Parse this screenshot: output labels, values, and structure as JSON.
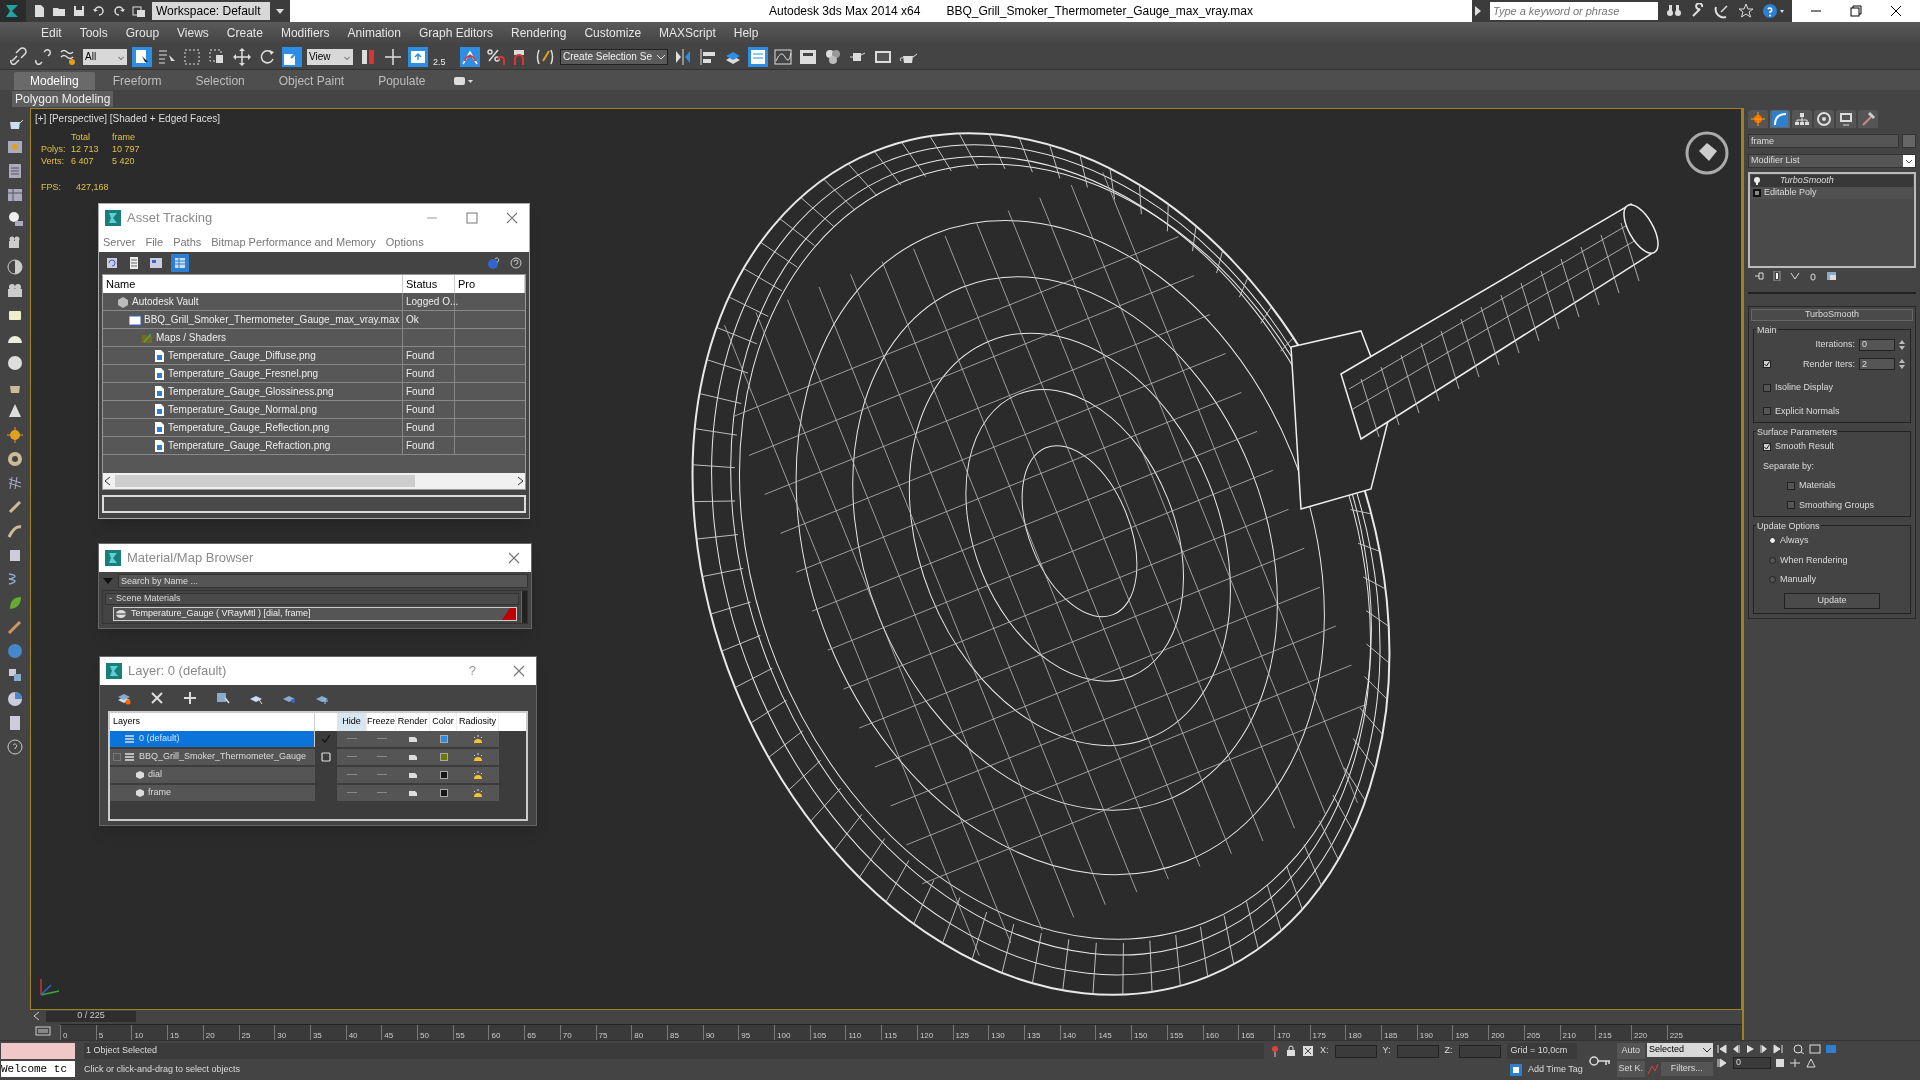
{
  "window": {
    "app_title": "Autodesk 3ds Max  2014 x64",
    "file_title": "BBQ_Grill_Smoker_Thermometer_Gauge_max_vray.max",
    "workspace": "Workspace: Default",
    "search_placeholder": "Type a keyword or phrase"
  },
  "menu": [
    "Edit",
    "Tools",
    "Group",
    "Views",
    "Create",
    "Modifiers",
    "Animation",
    "Graph Editors",
    "Rendering",
    "Customize",
    "MAXScript",
    "Help"
  ],
  "toolbar": {
    "selection_filter": "All",
    "reference_coord": "View",
    "snap_label": "2.5",
    "named_selection": "Create Selection Se"
  },
  "ribbon": {
    "tabs": [
      {
        "label": "Modeling",
        "selected": true
      },
      {
        "label": "Freeform",
        "selected": false
      },
      {
        "label": "Selection",
        "selected": false
      },
      {
        "label": "Object Paint",
        "selected": false
      },
      {
        "label": "Populate",
        "selected": false
      }
    ],
    "panel": "Polygon Modeling"
  },
  "viewport": {
    "label": "[+] [Perspective] [Shaded + Edged Faces]",
    "stats_header": [
      "Total",
      "frame"
    ],
    "stats": [
      {
        "label": "Polys:",
        "total": "12 713",
        "frame": "10 797"
      },
      {
        "label": "Verts:",
        "total": "6 407",
        "frame": "5 420"
      }
    ],
    "fps_label": "FPS:",
    "fps": "427,168"
  },
  "asset_tracking": {
    "title": "Asset Tracking",
    "menu": [
      "Server",
      "File",
      "Paths",
      "Bitmap Performance and Memory",
      "Options"
    ],
    "columns": [
      "Name",
      "Status",
      "Pro"
    ],
    "tree": [
      {
        "kind": "vault",
        "name": "Autodesk Vault",
        "status": "Logged O...",
        "children": [
          {
            "kind": "scene",
            "name": "BBQ_Grill_Smoker_Thermometer_Gauge_max_vray.max",
            "status": "Ok",
            "children": [
              {
                "kind": "folder",
                "name": "Maps / Shaders",
                "children": [
                  {
                    "kind": "bitmap",
                    "name": "Temperature_Gauge_Diffuse.png",
                    "status": "Found"
                  },
                  {
                    "kind": "bitmap",
                    "name": "Temperature_Gauge_Fresnel.png",
                    "status": "Found"
                  },
                  {
                    "kind": "bitmap",
                    "name": "Temperature_Gauge_Glossiness.png",
                    "status": "Found"
                  },
                  {
                    "kind": "bitmap",
                    "name": "Temperature_Gauge_Normal.png",
                    "status": "Found"
                  },
                  {
                    "kind": "bitmap",
                    "name": "Temperature_Gauge_Reflection.png",
                    "status": "Found"
                  },
                  {
                    "kind": "bitmap",
                    "name": "Temperature_Gauge_Refraction.png",
                    "status": "Found"
                  }
                ]
              }
            ]
          }
        ]
      }
    ]
  },
  "material_browser": {
    "title": "Material/Map Browser",
    "search_placeholder": "Search by Name ...",
    "group_toggle": "-",
    "group": "Scene Materials",
    "materials": [
      "Temperature_Gauge ( VRayMtl ) [dial, frame]"
    ]
  },
  "layer_dialog": {
    "title": "Layer: 0 (default)",
    "help": "?",
    "columns": [
      "Layers",
      "Hide",
      "Freeze",
      "Render",
      "Color",
      "Radiosity"
    ],
    "layers": [
      {
        "name": "0 (default)",
        "selected": true,
        "current": true,
        "color": "#2f8ae0"
      },
      {
        "name": "BBQ_Grill_Smoker_Thermometer_Gauge",
        "selected": false,
        "current": false,
        "expanded": true,
        "color": "#6b7a00",
        "children": [
          {
            "name": "dial",
            "color": "#151515"
          },
          {
            "name": "frame",
            "color": "#151515"
          }
        ]
      }
    ]
  },
  "command_panel": {
    "panel_tabs": [
      {
        "selected": false
      },
      {
        "selected": true
      },
      {
        "selected": false
      },
      {
        "selected": false
      },
      {
        "selected": false
      },
      {
        "selected": false
      }
    ],
    "object_name": "frame",
    "modifier_list": "Modifier List",
    "stack": [
      {
        "label": "TurboSmooth",
        "selected": true
      },
      {
        "label": "Editable Poly",
        "selected": false
      }
    ],
    "rollout": "TurboSmooth",
    "main_group": "Main",
    "iterations_label": "Iterations:",
    "iterations": "0",
    "render_iters_label": "Render Iters:",
    "render_iters": "2",
    "render_iters_checked": true,
    "options": [
      {
        "label": "Isoline Display",
        "checked": false
      },
      {
        "label": "Explicit Normals",
        "checked": false
      }
    ],
    "surface_group": "Surface Parameters",
    "smooth_result": {
      "label": "Smooth Result",
      "checked": true
    },
    "separate_label": "Separate by:",
    "separate": [
      {
        "label": "Materials",
        "checked": false
      },
      {
        "label": "Smoothing Groups",
        "checked": false
      }
    ],
    "update_group": "Update Options",
    "update_modes": [
      {
        "label": "Always",
        "selected": true
      },
      {
        "label": "When Rendering",
        "selected": false
      },
      {
        "label": "Manually",
        "selected": false
      }
    ],
    "update_button": "Update"
  },
  "timeline": {
    "frame": "0 / 225",
    "level": 0,
    "ruler": [
      "0",
      "5",
      "10",
      "15",
      "20",
      "25",
      "30",
      "35",
      "40",
      "45",
      "50",
      "55",
      "60",
      "65",
      "70",
      "75",
      "80",
      "85",
      "90",
      "95",
      "100",
      "105",
      "110",
      "115",
      "120",
      "125",
      "130",
      "135",
      "140",
      "145",
      "150",
      "155",
      "160",
      "165",
      "170",
      "175",
      "180",
      "185",
      "190",
      "195",
      "200",
      "205",
      "210",
      "215",
      "220",
      "225"
    ]
  },
  "status_bar": {
    "listener": "Welcome tc",
    "selection": "1 Object Selected",
    "prompt": "Click or click-and-drag to select objects",
    "x_label": "X:",
    "y_label": "Y:",
    "z_label": "Z:",
    "grid": "Grid = 10,0cm",
    "time_tag": "Add Time Tag",
    "auto_key": "Auto",
    "key_mode": "Selected",
    "set_key": "Set K.",
    "filters": "Filters...",
    "current_frame": "0"
  }
}
